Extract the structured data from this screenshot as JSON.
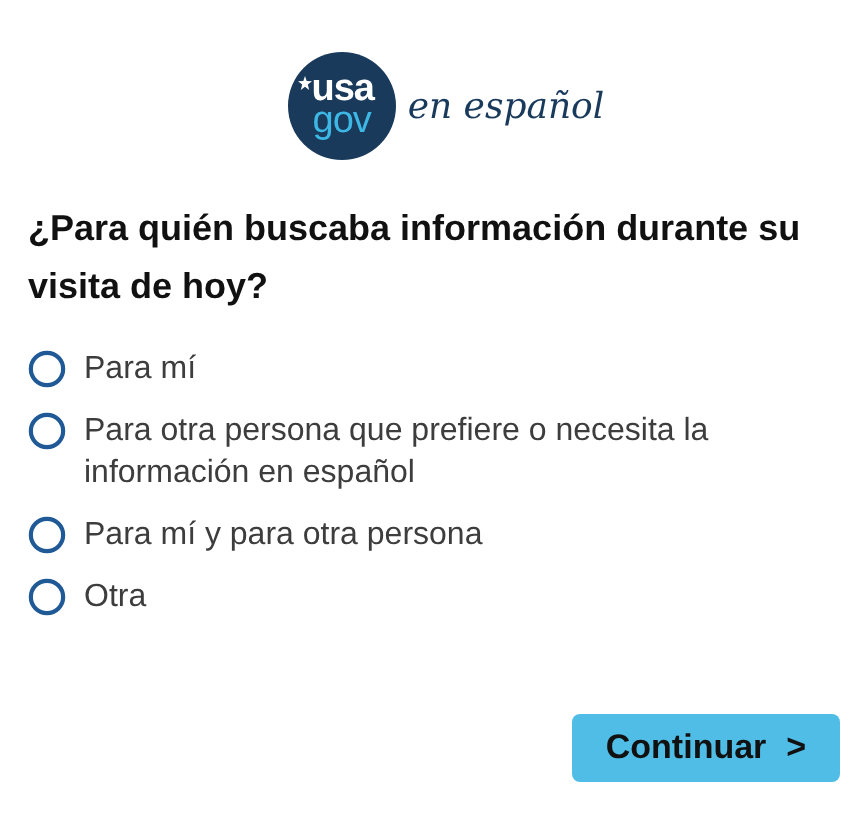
{
  "logo": {
    "mark_top": "usa",
    "mark_bottom": "gov",
    "tagline": "en español"
  },
  "question": "¿Para quién buscaba información durante su visita de hoy?",
  "options": [
    {
      "label": "Para mí",
      "selected": false
    },
    {
      "label": "Para otra persona que prefiere o necesita la información en español",
      "selected": false
    },
    {
      "label": "Para mí y para otra persona",
      "selected": false
    },
    {
      "label": "Otra",
      "selected": false
    }
  ],
  "button": {
    "label": "Continuar",
    "arrow": ">"
  }
}
